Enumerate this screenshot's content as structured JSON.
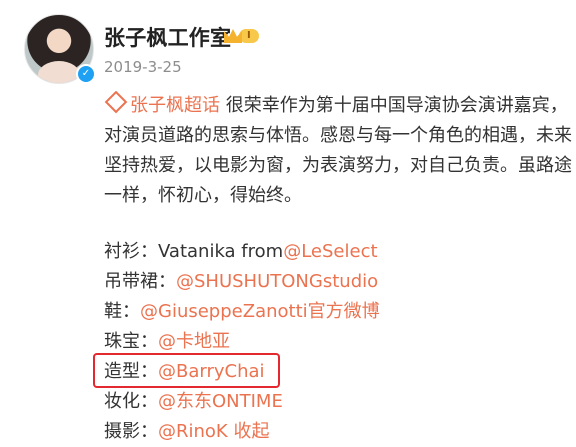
{
  "user": {
    "name": "张子枫工作室",
    "vip_level": "I",
    "date": "2019-3-25"
  },
  "post": {
    "topic": "张子枫超话",
    "line1_text": " 很荣幸作为第十届中国导演协会演讲嘉宾，",
    "line2": "对演员道路的思索与体悟。感恩与每一个角色的相遇，未来",
    "line3": "坚持热爱，以电影为窗，为表演努力，对自己负责。虽路途",
    "line4": "一样，怀初心，得始终。"
  },
  "credits": [
    {
      "label": "衬衫：",
      "prefix": "Vatanika from",
      "mention": "@LeSelect"
    },
    {
      "label": "吊带裙：",
      "prefix": "",
      "mention": "@SHUSHUTONGstudio"
    },
    {
      "label": "鞋：",
      "prefix": "",
      "mention": "@GiuseppeZanotti官方微博"
    },
    {
      "label": "珠宝：",
      "prefix": "",
      "mention": "@卡地亚"
    },
    {
      "label": "造型：",
      "prefix": "",
      "mention": "@BarryChai"
    },
    {
      "label": "妆化：",
      "prefix": "",
      "mention": "@东东ONTIME"
    },
    {
      "label": "摄影：",
      "prefix": "",
      "mention": "@RinoK 收起"
    }
  ],
  "colors": {
    "link": "#eb7350",
    "highlight_border": "#e3282f",
    "verified": "#1ea1f2"
  }
}
